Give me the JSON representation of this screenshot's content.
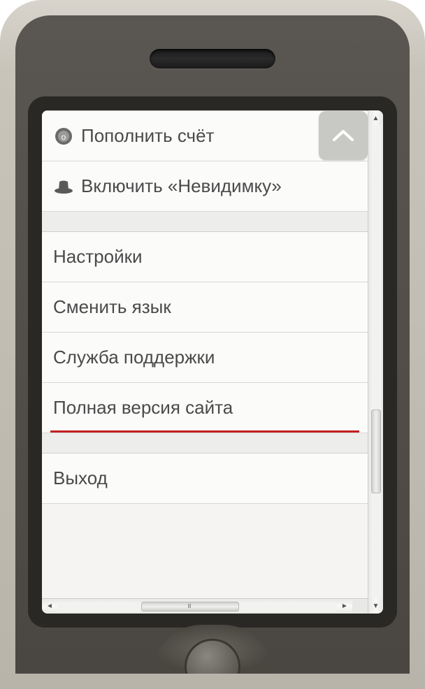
{
  "menu": {
    "group1": [
      {
        "label": "Пополнить счёт",
        "icon": "coin"
      },
      {
        "label": "Включить «Невидимку»",
        "icon": "hat"
      }
    ],
    "group2": [
      {
        "label": "Настройки"
      },
      {
        "label": "Сменить язык"
      },
      {
        "label": "Служба поддержки"
      },
      {
        "label": "Полная версия сайта",
        "underlined": true
      }
    ],
    "group3": [
      {
        "label": "Выход"
      }
    ]
  },
  "icons": {
    "coin": "coin-icon",
    "hat": "hat-icon",
    "up": "chevron-up-icon"
  }
}
